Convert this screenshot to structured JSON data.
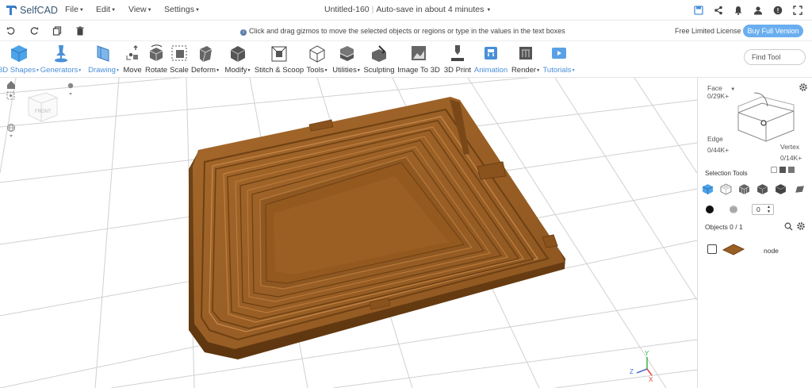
{
  "app": {
    "name": "SelfCAD"
  },
  "menu": [
    {
      "label": "File"
    },
    {
      "label": "Edit"
    },
    {
      "label": "View"
    },
    {
      "label": "Settings"
    }
  ],
  "document": {
    "title": "Untitled-160",
    "autosave": "Auto-save in about 4 minutes"
  },
  "hint": "Click and drag gizmos to move the selected objects or regions or type in the values in the text boxes",
  "license": {
    "label": "Free Limited License",
    "buy_label": "Buy Full Version"
  },
  "toolbar": {
    "items": [
      {
        "label": "3D Shapes",
        "dropdown": true,
        "blue": true,
        "icon": "cube-icon"
      },
      {
        "label": "Generators",
        "dropdown": true,
        "blue": true,
        "icon": "pin-icon"
      },
      {
        "label": "Drawing",
        "dropdown": true,
        "blue": true,
        "icon": "pencil-plane-icon"
      },
      {
        "label": "Move",
        "icon": "move-icon"
      },
      {
        "label": "Rotate",
        "icon": "rotate-icon"
      },
      {
        "label": "Scale",
        "icon": "scale-icon"
      },
      {
        "label": "Deform",
        "dropdown": true,
        "icon": "deform-icon"
      },
      {
        "label": "Modify",
        "dropdown": true,
        "icon": "modify-icon"
      },
      {
        "label": "Stitch & Scoop",
        "icon": "stitch-icon"
      },
      {
        "label": "Tools",
        "dropdown": true,
        "icon": "tools-icon"
      },
      {
        "label": "Utilities",
        "dropdown": true,
        "icon": "utilities-icon"
      },
      {
        "label": "Sculpting",
        "icon": "sculpt-icon"
      },
      {
        "label": "Image To 3D",
        "icon": "image-3d-icon"
      },
      {
        "label": "3D Print",
        "icon": "print-icon"
      },
      {
        "label": "Animation",
        "blue": true,
        "icon": "animation-icon"
      },
      {
        "label": "Render",
        "dropdown": true,
        "icon": "render-icon"
      },
      {
        "label": "Tutorials",
        "dropdown": true,
        "blue": true,
        "icon": "tutorials-icon"
      }
    ],
    "find_placeholder": "Find Tool"
  },
  "selection_panel": {
    "face_label": "Face",
    "face_count": "0/29K+",
    "edge_label": "Edge",
    "edge_count": "0/44K+",
    "vertex_label": "Vertex",
    "vertex_count": "0/14K+",
    "selection_tools_label": "Selection Tools",
    "stepper_value": "0",
    "objects_label": "Objects 0 / 1",
    "object_name": "node"
  },
  "axes": {
    "x": "X",
    "y": "Y",
    "z": "Z"
  },
  "colors": {
    "model": "#9a5f24",
    "model_dark": "#6f4215",
    "model_light": "#b5793b",
    "accent": "#6aaef0",
    "icon_blue": "#4a8fd8"
  }
}
